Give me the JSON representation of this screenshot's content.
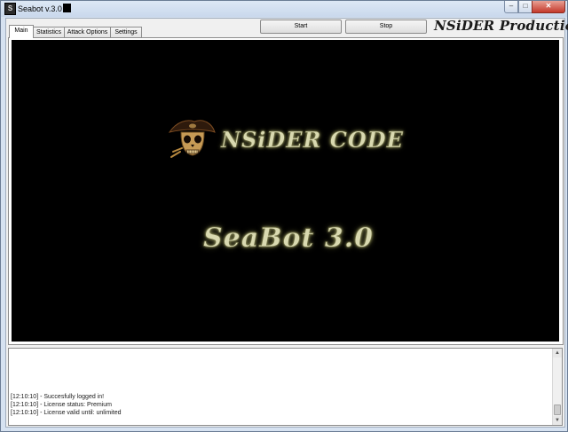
{
  "window": {
    "title": "Seabot v.3.0",
    "icon_letter": "S",
    "minimize_glyph": "–",
    "maximize_glyph": "□",
    "close_glyph": "✕"
  },
  "tabs": [
    {
      "label": "Main",
      "active": true
    },
    {
      "label": "Statistics",
      "active": false
    },
    {
      "label": "Attack Options",
      "active": false
    },
    {
      "label": "Settings",
      "active": false
    }
  ],
  "toolbar": {
    "start_label": "Start",
    "stop_label": "Stop",
    "brand": "NSiDER Productions"
  },
  "splash": {
    "logo_text": "NSiDER CODE",
    "product_text": "SeaBot 3.0",
    "background": "#000000",
    "text_color": "#d9d9b0",
    "icon": "pirate-skull-icon"
  },
  "log": {
    "lines": [
      "[12:10:10] - Succesfully logged in!",
      "[12:10:10] - License status: Premium",
      "[12:10:10] - License valid until: unlimited"
    ]
  }
}
